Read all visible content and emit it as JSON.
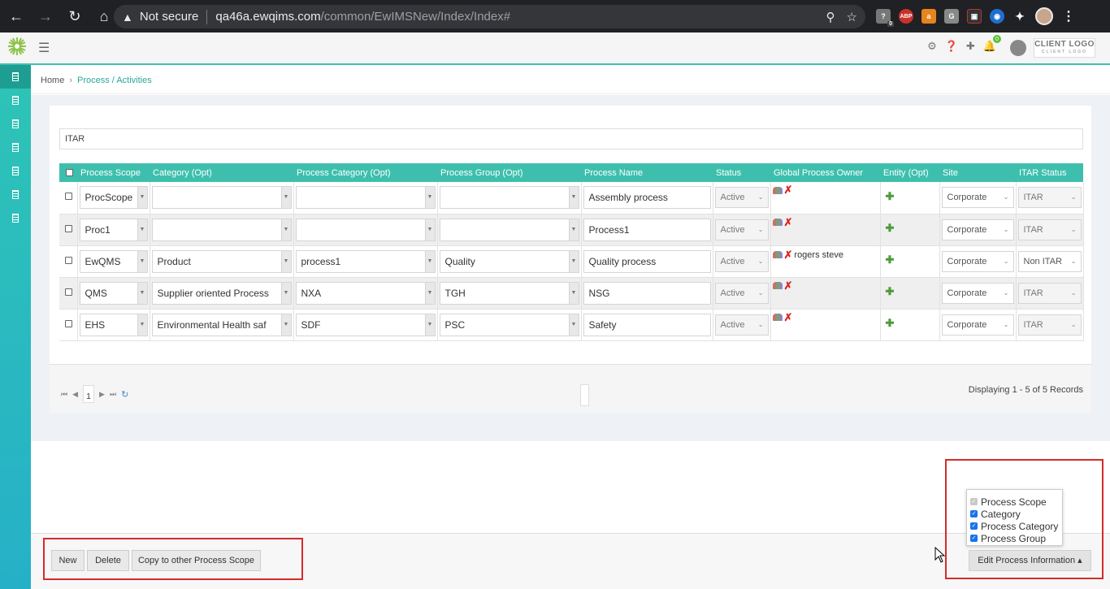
{
  "browser": {
    "security_label": "Not secure",
    "url_host": "qa46a.ewqims.com",
    "url_path": "/common/EwIMSNew/Index/Index#",
    "ext_badge": "0",
    "abp_label": "ABP"
  },
  "header": {
    "client_logo": "CLIENT LOGO",
    "client_logo_sub": "CLIENT LOGO",
    "notif_count": "0"
  },
  "breadcrumb": {
    "home": "Home",
    "current": "Process / Activities"
  },
  "filter": {
    "value": "ITAR"
  },
  "grid": {
    "columns": [
      "Process Scope",
      "Category (Opt)",
      "Process Category (Opt)",
      "Process Group (Opt)",
      "Process Name",
      "Status",
      "Global Process Owner",
      "Entity (Opt)",
      "Site",
      "ITAR Status"
    ],
    "rows": [
      {
        "scope": "ProcScope",
        "category": "",
        "pcategory": "",
        "pgroup": "",
        "name": "Assembly process",
        "status": "Active",
        "owner": "",
        "site": "Corporate",
        "itar": "ITAR"
      },
      {
        "scope": "Proc1",
        "category": "",
        "pcategory": "",
        "pgroup": "",
        "name": "Process1",
        "status": "Active",
        "owner": "",
        "site": "Corporate",
        "itar": "ITAR"
      },
      {
        "scope": "EwQMS",
        "category": "Product",
        "pcategory": "process1",
        "pgroup": "Quality",
        "name": "Quality process",
        "status": "Active",
        "owner": "rogers steve",
        "site": "Corporate",
        "itar": "Non ITAR"
      },
      {
        "scope": "QMS",
        "category": "Supplier oriented Process",
        "pcategory": "NXA",
        "pgroup": "TGH",
        "name": "NSG",
        "status": "Active",
        "owner": "",
        "site": "Corporate",
        "itar": "ITAR"
      },
      {
        "scope": "EHS",
        "category": "Environmental Health saf",
        "pcategory": "SDF",
        "pgroup": "PSC",
        "name": "Safety",
        "status": "Active",
        "owner": "",
        "site": "Corporate",
        "itar": "ITAR"
      }
    ]
  },
  "pager": {
    "page": "1",
    "displaying": "Displaying 1 - 5 of 5 Records"
  },
  "toolbar": {
    "new_label": "New",
    "delete_label": "Delete",
    "copy_label": "Copy to other Process Scope",
    "edit_label": "Edit Process Information"
  },
  "column_menu": {
    "options": [
      {
        "label": "Process Scope",
        "checked": true,
        "disabled": true
      },
      {
        "label": "Category",
        "checked": true,
        "disabled": false
      },
      {
        "label": "Process Category",
        "checked": true,
        "disabled": false
      },
      {
        "label": "Process Group",
        "checked": true,
        "disabled": false
      }
    ]
  },
  "colors": {
    "accent": "#3ebfad",
    "sidebar": "#2ec4b6",
    "highlight_frame": "#d42b2b"
  }
}
